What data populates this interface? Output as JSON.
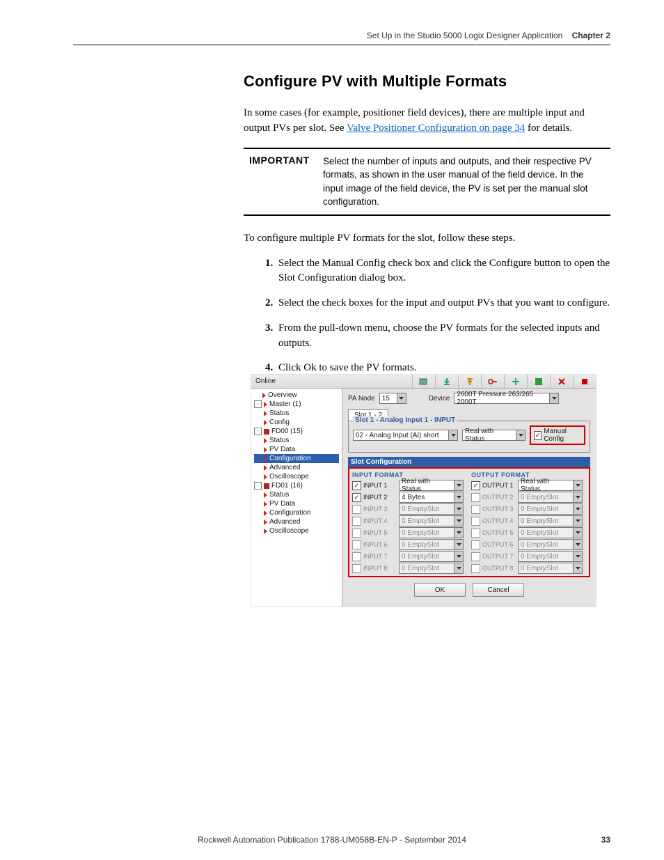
{
  "header": {
    "title": "Set Up in the Studio 5000 Logix Designer Application",
    "chapter": "Chapter 2"
  },
  "section": {
    "heading": "Configure PV with Multiple Formats",
    "intro_a": "In some cases (for example, positioner field devices), there are multiple input and output PVs per slot. See ",
    "intro_link": "Valve Positioner Configuration on page 34",
    "intro_b": " for details.",
    "important_label": "IMPORTANT",
    "important_text": "Select the number of inputs and outputs, and their respective PV formats, as shown in the user manual of the field device. In the input image of the field device, the PV is set per the manual slot configuration.",
    "lead": "To configure multiple PV formats for the slot, follow these steps.",
    "steps": [
      "Select the Manual Config check box and click the Configure button to open the Slot Configuration dialog box.",
      "Select the check boxes for the input and output PVs that you want to configure.",
      "From the pull-down menu, choose the PV formats for the selected inputs and outputs.",
      "Click Ok to save the PV formats."
    ]
  },
  "screenshot": {
    "online": "Online",
    "tree": {
      "overview": "Overview",
      "master": "Master (1)",
      "status": "Status",
      "config": "Config",
      "fd00": "FD00 (15)",
      "pvdata": "PV Data",
      "configuration": "Configuration",
      "advanced": "Advanced",
      "oscilloscope": "Oscilloscope",
      "fd01": "FD01 (16)"
    },
    "panel": {
      "pa_node_label": "PA Node",
      "pa_node_value": "15",
      "device_label": "Device",
      "device_value": "2600T Pressure 263/265 2000T",
      "tab": "Slot 1 - 2",
      "grp_legend": "Slot 1 - Analog Input 1 - INPUT",
      "slot_type": "02 - Analog Input (AI) short",
      "slot_fmt": "Real with Status",
      "manual_label": "Manual Config",
      "sc_title": "Slot Configuration",
      "input_title": "INPUT FORMAT",
      "output_title": "OUTPUT FORMAT",
      "inputs": [
        {
          "name": "INPUT 1",
          "val": "Real with Status",
          "checked": true,
          "enabled": true
        },
        {
          "name": "INPUT 2",
          "val": "4 Bytes",
          "checked": true,
          "enabled": true
        },
        {
          "name": "INPUT 3",
          "val": "0 EmptySlot",
          "checked": false,
          "enabled": false
        },
        {
          "name": "INPUT 4",
          "val": "0 EmptySlot",
          "checked": false,
          "enabled": false
        },
        {
          "name": "INPUT 5",
          "val": "0 EmptySlot",
          "checked": false,
          "enabled": false
        },
        {
          "name": "INPUT 6",
          "val": "0 EmptySlot",
          "checked": false,
          "enabled": false
        },
        {
          "name": "INPUT 7",
          "val": "0 EmptySlot",
          "checked": false,
          "enabled": false
        },
        {
          "name": "INPUT 8",
          "val": "0 EmptySlot",
          "checked": false,
          "enabled": false
        }
      ],
      "outputs": [
        {
          "name": "OUTPUT 1",
          "val": "Real with Status",
          "checked": true,
          "enabled": true
        },
        {
          "name": "OUTPUT 2",
          "val": "0 EmptySlot",
          "checked": false,
          "enabled": false
        },
        {
          "name": "OUTPUT 3",
          "val": "0 EmptySlot",
          "checked": false,
          "enabled": false
        },
        {
          "name": "OUTPUT 4",
          "val": "0 EmptySlot",
          "checked": false,
          "enabled": false
        },
        {
          "name": "OUTPUT 5",
          "val": "0 EmptySlot",
          "checked": false,
          "enabled": false
        },
        {
          "name": "OUTPUT 6",
          "val": "0 EmptySlot",
          "checked": false,
          "enabled": false
        },
        {
          "name": "OUTPUT 7",
          "val": "0 EmptySlot",
          "checked": false,
          "enabled": false
        },
        {
          "name": "OUTPUT 8",
          "val": "0 EmptySlot",
          "checked": false,
          "enabled": false
        }
      ],
      "ok": "OK",
      "cancel": "Cancel"
    }
  },
  "footer": {
    "text": "Rockwell Automation Publication 1788-UM058B-EN-P - September 2014",
    "page": "33"
  }
}
